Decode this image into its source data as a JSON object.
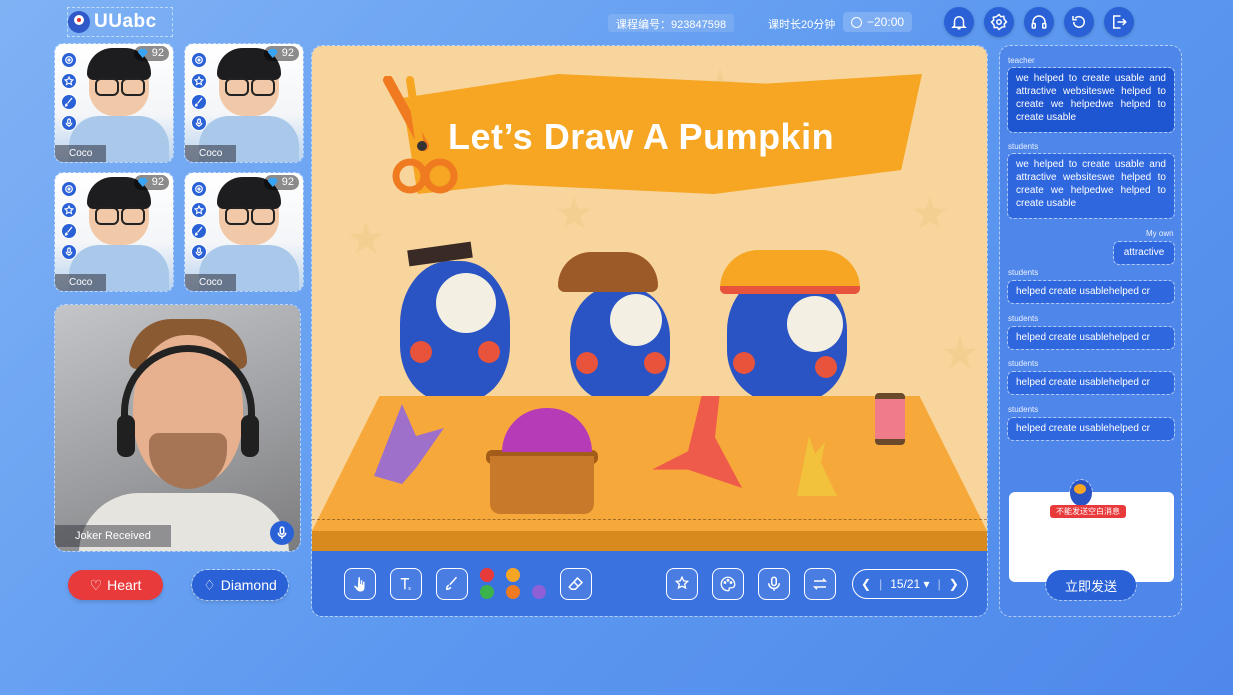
{
  "app": {
    "logo_text": "UUabc"
  },
  "header": {
    "course_no": "课程编号：923847598",
    "duration": "课时长20分钟",
    "timer": "−20:00"
  },
  "top_icons": [
    "bell-icon",
    "settings-icon",
    "headset-icon",
    "refresh-icon",
    "exit-icon"
  ],
  "students": [
    {
      "name": "Coco",
      "gems": "92"
    },
    {
      "name": "Coco",
      "gems": "92"
    },
    {
      "name": "Coco",
      "gems": "92"
    },
    {
      "name": "Coco",
      "gems": "92"
    }
  ],
  "teacher_video": {
    "label": "Joker Received"
  },
  "rewards": {
    "heart_label": "Heart",
    "diamond_label": "Diamond"
  },
  "stage": {
    "title": "Let’s Draw A Pumpkin"
  },
  "toolbar": {
    "pager": "15/21 ▾",
    "colors": [
      "#e8393b",
      "#f6a623",
      "#3a72e0",
      "#3bb34a",
      "#f07a1f",
      "#8f5fd6"
    ]
  },
  "chat": {
    "messages": [
      {
        "sender": "teacher",
        "text": "we helped to create usable and attractive websiteswe helped to create we helpedwe helped to create usable"
      },
      {
        "sender": "students",
        "text": "we helped to create usable and attractive websiteswe helped to create we helpedwe helped to create usable"
      },
      {
        "sender": "My own",
        "text": "attractive"
      },
      {
        "sender": "students",
        "text": "helped create usablehelped cr"
      },
      {
        "sender": "students",
        "text": "helped create usablehelped cr"
      },
      {
        "sender": "students",
        "text": "helped create usablehelped cr"
      },
      {
        "sender": "students",
        "text": "helped create usablehelped cr"
      }
    ],
    "warning": "不能发送空白消息",
    "send_label": "立即发送"
  }
}
